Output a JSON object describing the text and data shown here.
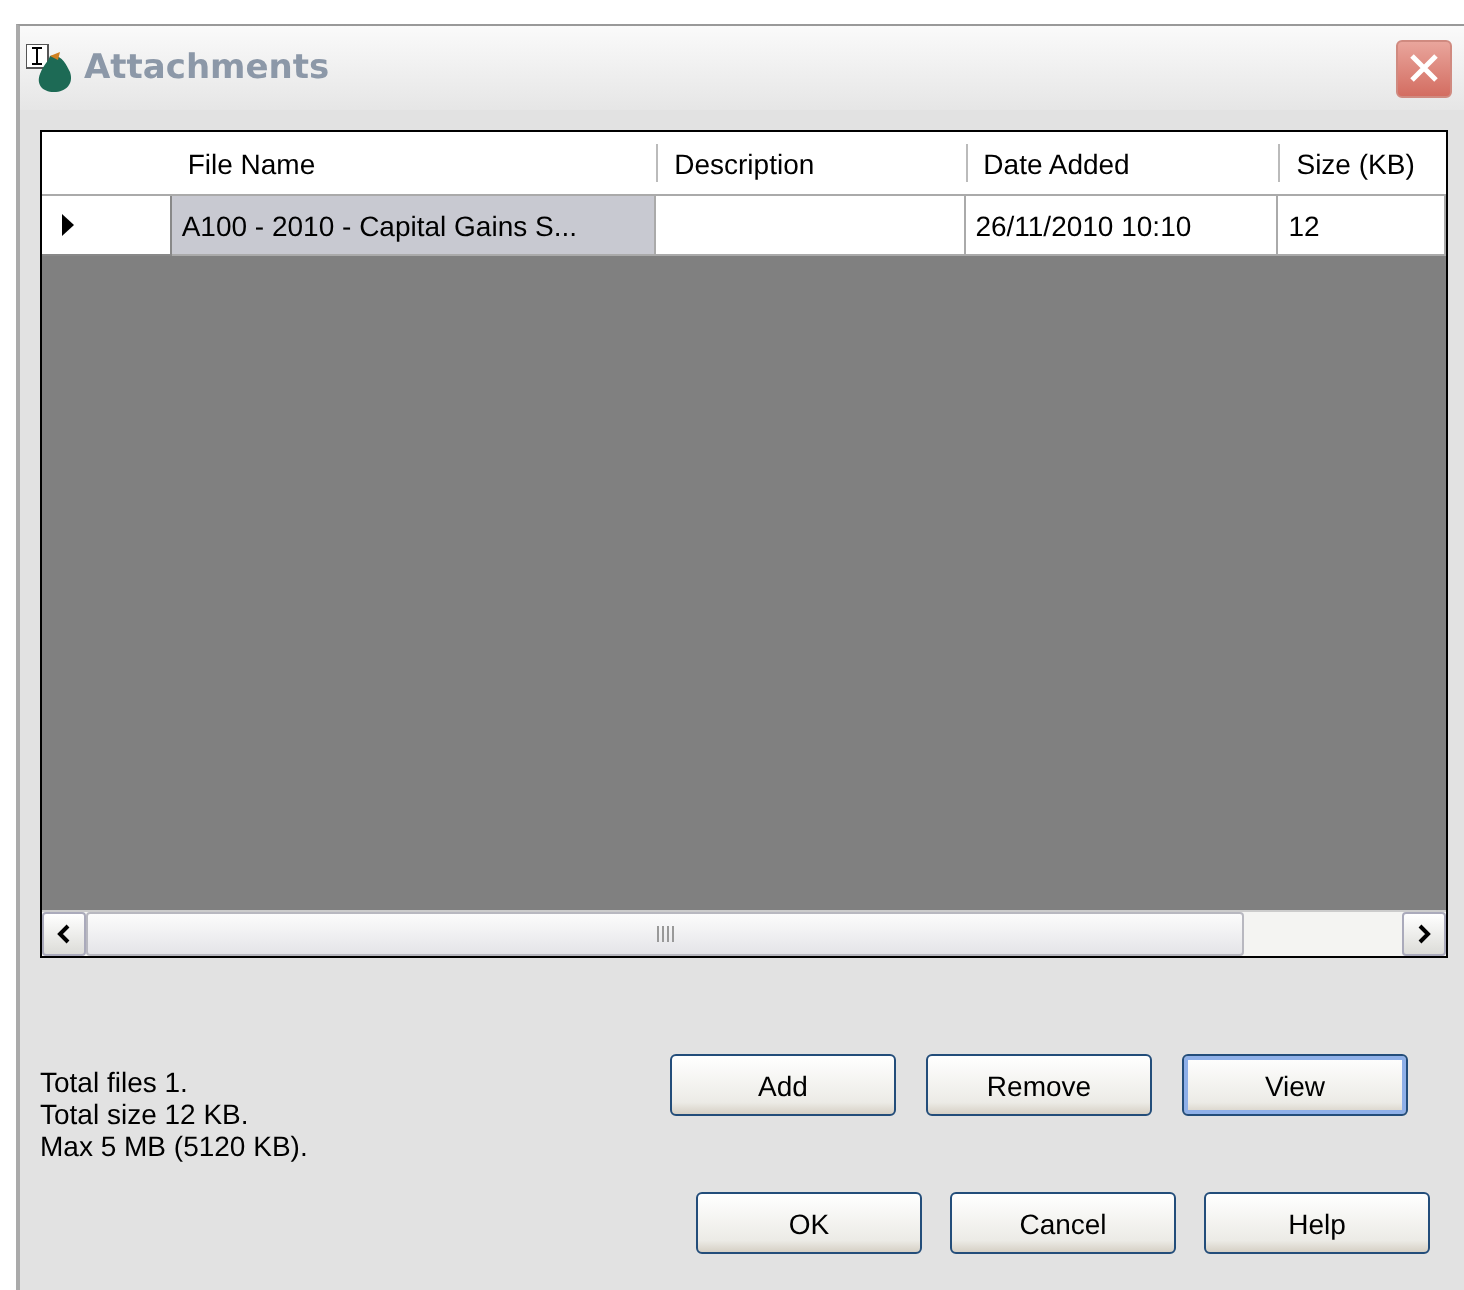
{
  "window": {
    "title": "Attachments"
  },
  "table": {
    "columns": [
      "File Name",
      "Description",
      "Date Added",
      "Size (KB)"
    ],
    "rows": [
      {
        "selected": true,
        "cells": [
          "A100 - 2010 - Capital Gains S...",
          "",
          "26/11/2010 10:10",
          "12"
        ]
      }
    ]
  },
  "summary": [
    "Total files 1.",
    "Total size 12 KB.",
    "Max 5 MB (5120 KB)."
  ],
  "buttons": [
    {
      "label": "Add",
      "focused": false
    },
    {
      "label": "Remove",
      "focused": false
    },
    {
      "label": "View",
      "focused": true
    }
  ],
  "dialog_buttons": [
    {
      "label": "OK",
      "focused": false
    },
    {
      "label": "Cancel",
      "focused": false
    },
    {
      "label": "Help",
      "focused": false
    }
  ]
}
